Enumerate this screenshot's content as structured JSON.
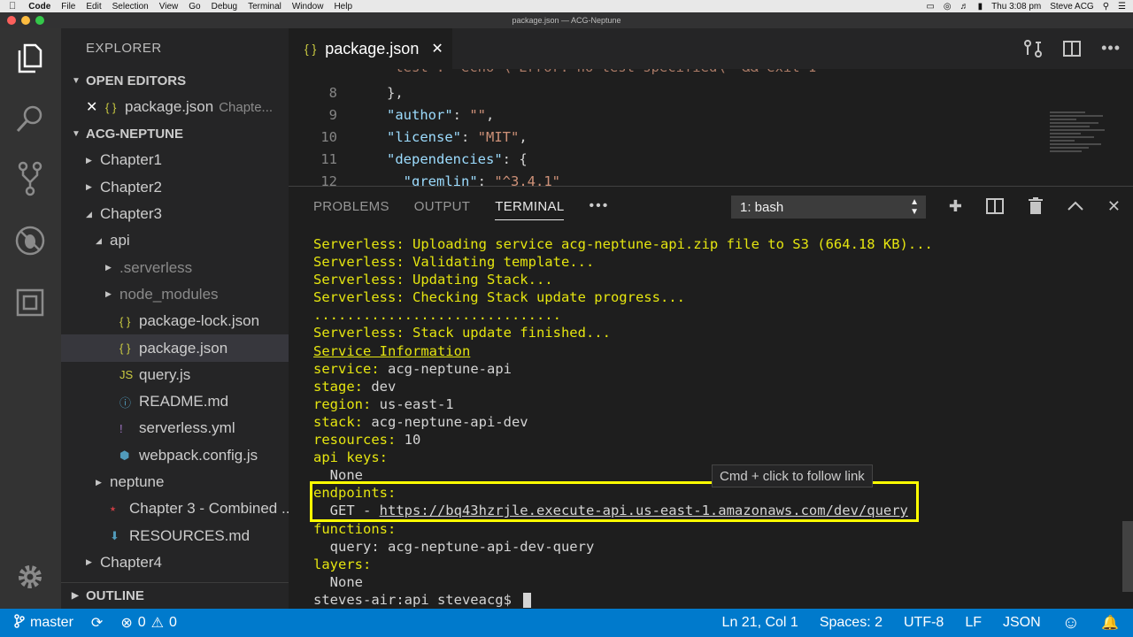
{
  "menubar": {
    "app_name": "Code",
    "items": [
      "File",
      "Edit",
      "Selection",
      "View",
      "Go",
      "Debug",
      "Terminal",
      "Window",
      "Help"
    ],
    "clock": "Thu 3:08 pm",
    "user": "Steve ACG"
  },
  "window": {
    "title": "package.json — ACG-Neptune"
  },
  "sidebar": {
    "title": "EXPLORER",
    "open_editors_label": "OPEN EDITORS",
    "open_editor": {
      "name": "package.json",
      "description": "Chapte..."
    },
    "project_label": "ACG-NEPTUNE",
    "tree": [
      {
        "label": "Chapter1",
        "indent": 0,
        "type": "folder",
        "expanded": false
      },
      {
        "label": "Chapter2",
        "indent": 0,
        "type": "folder",
        "expanded": false
      },
      {
        "label": "Chapter3",
        "indent": 0,
        "type": "folder",
        "expanded": true
      },
      {
        "label": "api",
        "indent": 1,
        "type": "folder",
        "expanded": true
      },
      {
        "label": ".serverless",
        "indent": 2,
        "type": "folder",
        "expanded": false,
        "dim": true
      },
      {
        "label": "node_modules",
        "indent": 2,
        "type": "folder",
        "expanded": false,
        "dim": true
      },
      {
        "label": "package-lock.json",
        "indent": 2,
        "type": "json"
      },
      {
        "label": "package.json",
        "indent": 2,
        "type": "json",
        "selected": true
      },
      {
        "label": "query.js",
        "indent": 2,
        "type": "js"
      },
      {
        "label": "README.md",
        "indent": 2,
        "type": "info"
      },
      {
        "label": "serverless.yml",
        "indent": 2,
        "type": "yml"
      },
      {
        "label": "webpack.config.js",
        "indent": 2,
        "type": "webpack"
      },
      {
        "label": "neptune",
        "indent": 1,
        "type": "folder",
        "expanded": false
      },
      {
        "label": "Chapter 3 - Combined ...",
        "indent": 1,
        "type": "pdf"
      },
      {
        "label": "RESOURCES.md",
        "indent": 1,
        "type": "md"
      },
      {
        "label": "Chapter4",
        "indent": 0,
        "type": "folder",
        "expanded": false
      }
    ],
    "outline_label": "OUTLINE"
  },
  "editor": {
    "tab": {
      "label": "package.json"
    },
    "lines": [
      {
        "num": "8",
        "html": "<span class='p'>},</span>"
      },
      {
        "num": "9",
        "html": "<span class='k'>\"author\"</span><span class='p'>: </span><span class='s'>\"\"</span><span class='p'>,</span>"
      },
      {
        "num": "10",
        "html": "<span class='k'>\"license\"</span><span class='p'>: </span><span class='s'>\"MIT\"</span><span class='p'>,</span>"
      },
      {
        "num": "11",
        "html": "<span class='k'>\"dependencies\"</span><span class='p'>: {</span>"
      },
      {
        "num": "12",
        "html": "<span class='p'>  </span><span class='k'>\"gremlin\"</span><span class='p'>: </span><span class='s'>\"^3.4.1\"</span>"
      }
    ]
  },
  "panel": {
    "tabs": [
      "PROBLEMS",
      "OUTPUT",
      "TERMINAL"
    ],
    "active_tab": "TERMINAL",
    "more": "•••",
    "shell_select": "1: bash",
    "hover_tip": "Cmd + click to follow link",
    "terminal_lines": [
      [
        {
          "t": "Serverless: ",
          "c": "y"
        },
        {
          "t": "Uploading service acg-neptune-api.zip file to S3 (664.18 KB)...",
          "c": "y"
        }
      ],
      [
        {
          "t": "Serverless: ",
          "c": "y"
        },
        {
          "t": "Validating template...",
          "c": "y"
        }
      ],
      [
        {
          "t": "Serverless: ",
          "c": "y"
        },
        {
          "t": "Updating Stack...",
          "c": "y"
        }
      ],
      [
        {
          "t": "Serverless: ",
          "c": "y"
        },
        {
          "t": "Checking Stack update progress...",
          "c": "y"
        }
      ],
      [
        {
          "t": "..............................",
          "c": "y"
        }
      ],
      [
        {
          "t": "Serverless: ",
          "c": "y"
        },
        {
          "t": "Stack update finished...",
          "c": "y"
        }
      ],
      [
        {
          "t": "Service Information",
          "c": "yu"
        }
      ],
      [
        {
          "t": "service: ",
          "c": "y"
        },
        {
          "t": "acg-neptune-api",
          "c": "g"
        }
      ],
      [
        {
          "t": "stage: ",
          "c": "y"
        },
        {
          "t": "dev",
          "c": "g"
        }
      ],
      [
        {
          "t": "region: ",
          "c": "y"
        },
        {
          "t": "us-east-1",
          "c": "g"
        }
      ],
      [
        {
          "t": "stack: ",
          "c": "y"
        },
        {
          "t": "acg-neptune-api-dev",
          "c": "g"
        }
      ],
      [
        {
          "t": "resources: ",
          "c": "y"
        },
        {
          "t": "10",
          "c": "g"
        }
      ],
      [
        {
          "t": "api keys:",
          "c": "y"
        }
      ],
      [
        {
          "t": "  None",
          "c": "g"
        }
      ],
      [
        {
          "t": "endpoints:",
          "c": "y"
        }
      ],
      [
        {
          "t": "  GET - ",
          "c": "g"
        },
        {
          "t": "https://bq43hzrjle.execute-api.us-east-1.amazonaws.com/dev/query",
          "c": "g link"
        }
      ],
      [
        {
          "t": "functions:",
          "c": "y"
        }
      ],
      [
        {
          "t": "  query: ",
          "c": "g"
        },
        {
          "t": "acg-neptune-api-dev-query",
          "c": "g"
        }
      ],
      [
        {
          "t": "layers:",
          "c": "y"
        }
      ],
      [
        {
          "t": "  None",
          "c": "g"
        }
      ],
      [
        {
          "t": "steves-air:api steveacg$ ",
          "c": "g"
        }
      ]
    ]
  },
  "status": {
    "branch": "master",
    "errors": "0",
    "warnings": "0",
    "position": "Ln 21, Col 1",
    "spaces": "Spaces: 2",
    "encoding": "UTF-8",
    "eol": "LF",
    "language": "JSON"
  },
  "colors": {
    "status_bar": "#007acc",
    "highlight_box": "#ffff00",
    "terminal_yellow": "#e5e510"
  }
}
